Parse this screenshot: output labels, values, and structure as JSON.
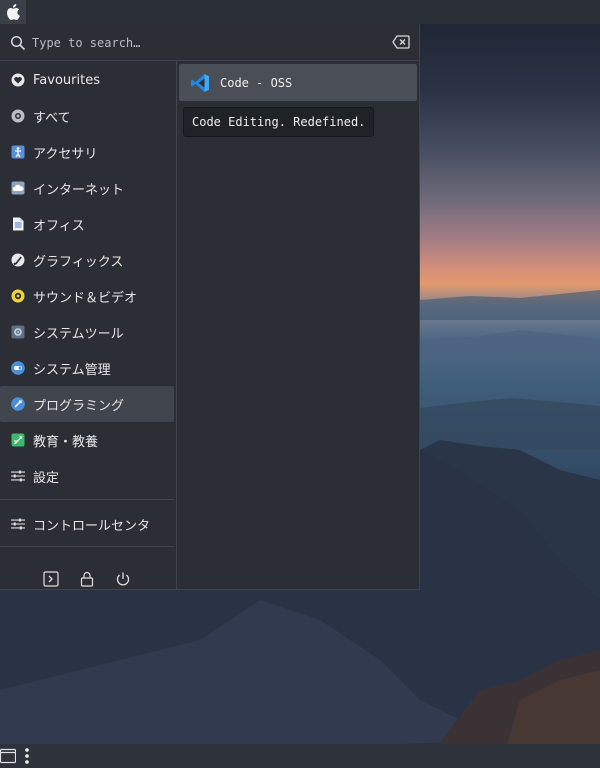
{
  "search": {
    "placeholder": "Type to search…",
    "value": ""
  },
  "sidebar": {
    "items": [
      {
        "label": "Favourites",
        "icon": "heart-icon"
      },
      {
        "label": "すべて",
        "icon": "all-apps-icon"
      },
      {
        "label": "アクセサリ",
        "icon": "accessories-icon"
      },
      {
        "label": "インターネット",
        "icon": "internet-icon"
      },
      {
        "label": "オフィス",
        "icon": "office-icon"
      },
      {
        "label": "グラフィックス",
        "icon": "graphics-icon"
      },
      {
        "label": "サウンド＆ビデオ",
        "icon": "multimedia-icon"
      },
      {
        "label": "システムツール",
        "icon": "system-tools-icon"
      },
      {
        "label": "システム管理",
        "icon": "administration-icon"
      },
      {
        "label": "プログラミング",
        "icon": "programming-icon"
      },
      {
        "label": "教育・教養",
        "icon": "education-icon"
      },
      {
        "label": "設定",
        "icon": "settings-icon"
      }
    ],
    "control_center": {
      "label": "コントロールセンタ",
      "icon": "control-center-icon"
    },
    "selected": "プログラミング"
  },
  "apps": [
    {
      "label": "Code - OSS",
      "icon": "vscode-icon",
      "tooltip": "Code Editing. Redefined."
    }
  ],
  "colors": {
    "accent": "#4a90d9",
    "panel": "#2b2e35",
    "selected": "#41454e"
  }
}
